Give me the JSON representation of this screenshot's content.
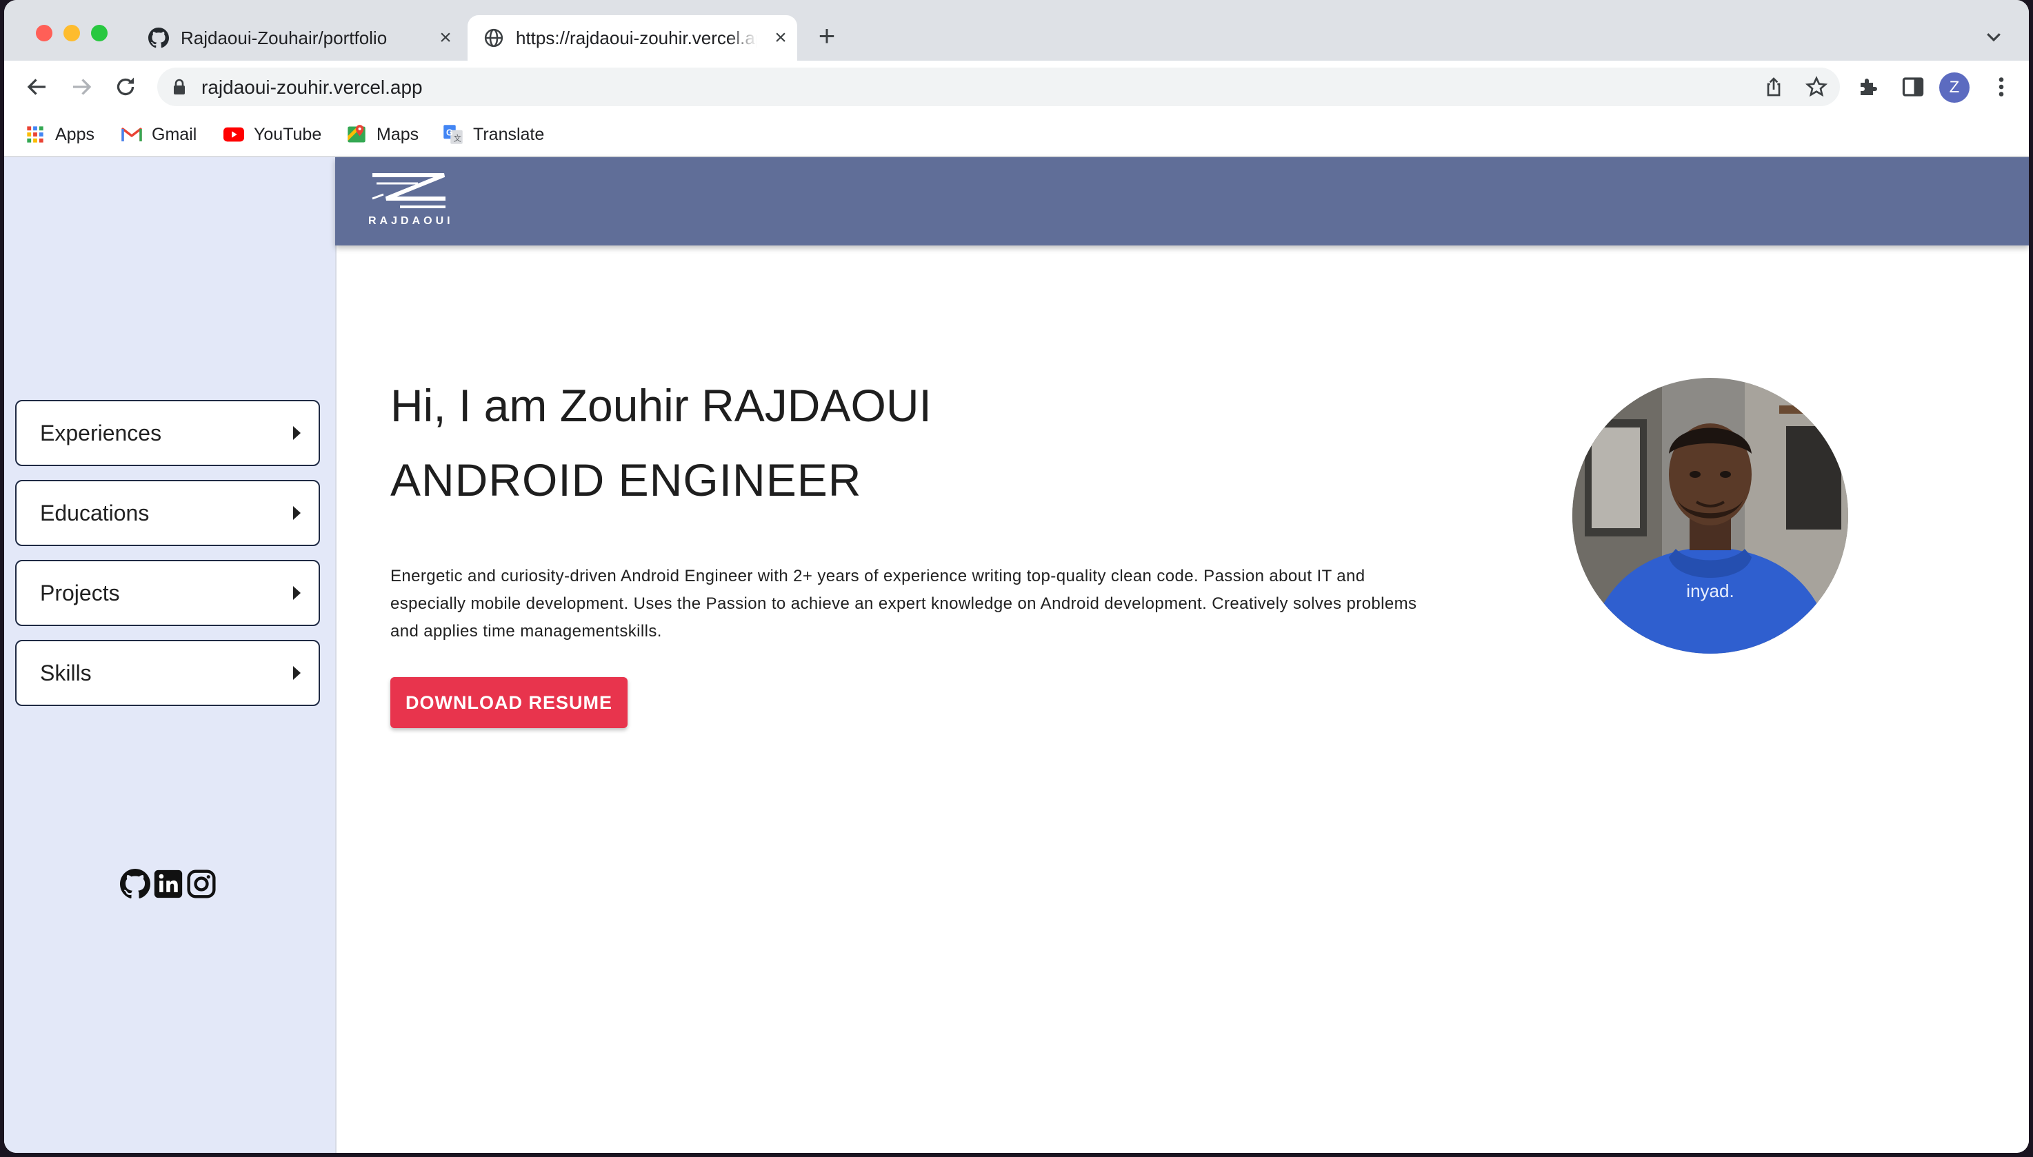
{
  "browser": {
    "tabs": [
      {
        "title": "Rajdaoui-Zouhair/portfolio",
        "favicon": "github-icon"
      },
      {
        "title": "https://rajdaoui-zouhir.vercel.app",
        "favicon": "globe-icon"
      }
    ],
    "close_glyph": "×",
    "new_tab_glyph": "+",
    "url": "rajdaoui-zouhir.vercel.app",
    "profile_initial": "Z",
    "bookmarks": [
      {
        "label": "Apps",
        "icon": "apps-grid-icon"
      },
      {
        "label": "Gmail",
        "icon": "gmail-icon"
      },
      {
        "label": "YouTube",
        "icon": "youtube-icon"
      },
      {
        "label": "Maps",
        "icon": "maps-icon"
      },
      {
        "label": "Translate",
        "icon": "translate-icon"
      }
    ]
  },
  "site": {
    "logo_text": "RAJDAOUI",
    "sidebar": {
      "items": [
        {
          "label": "Experiences"
        },
        {
          "label": "Educations"
        },
        {
          "label": "Projects"
        },
        {
          "label": "Skills"
        }
      ],
      "socials": [
        "github-icon",
        "linkedin-icon",
        "instagram-icon"
      ]
    },
    "hero": {
      "greeting": "Hi, I am Zouhir RAJDAOUI",
      "role": "ANDROID ENGINEER",
      "description": "Energetic and curiosity-driven Android Engineer with 2+ years of experience writing top-quality clean code. Passion about IT and especially mobile development. Uses the Passion to achieve an expert knowledge on Android development. Creatively solves problems and applies time managementskills.",
      "button": "DOWNLOAD RESUME",
      "hoodie_text": "inyad."
    }
  },
  "colors": {
    "header": "#606e98",
    "sidebar": "#e3e8f8",
    "accent": "#e8344d"
  }
}
